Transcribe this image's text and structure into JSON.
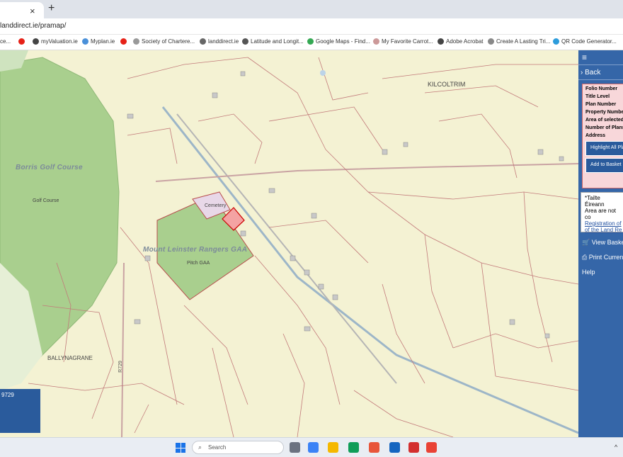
{
  "browser": {
    "tab_close": "×",
    "new_tab": "+",
    "url": "landdirect.ie/pramap/",
    "bookmarks": [
      {
        "label": "ce...",
        "color": "#888888"
      },
      {
        "label": "",
        "color": "#e62117"
      },
      {
        "label": "myValuation.ie",
        "color": "#444444"
      },
      {
        "label": "Myplan.ie",
        "color": "#4a90d9"
      },
      {
        "label": "",
        "color": "#e62117"
      },
      {
        "label": "Society of Chartere...",
        "color": "#999999"
      },
      {
        "label": "landdirect.ie",
        "color": "#666666"
      },
      {
        "label": "Latitude and Longit...",
        "color": "#555555"
      },
      {
        "label": "Google Maps - Find...",
        "color": "#34a853"
      },
      {
        "label": "My Favorite Carrot...",
        "color": "#cc9999"
      },
      {
        "label": "Adobe Acrobat",
        "color": "#444444"
      },
      {
        "label": "Create A Lasting Tri...",
        "color": "#888888"
      },
      {
        "label": "QR Code Generator...",
        "color": "#2d9cdb"
      }
    ]
  },
  "map": {
    "labels": {
      "kilcoltrim": "KILCOLTRIM",
      "borris_golf": "Borris Golf Course",
      "golf_course": "Golf Course",
      "cemetery": "Cemetery",
      "gaa": "Mount Leinster Rangers GAA",
      "pitch": "Pitch GAA",
      "ballynagrane": "BALLYNAGRANE",
      "road": "R729"
    },
    "coord_text": "9729"
  },
  "sidebar": {
    "menu_icon": "≡",
    "back": "Back",
    "info_rows": [
      "Folio Number",
      "Title Level",
      "Plan Number",
      "Property Number",
      "Area of selected",
      "Number of Plans this folio:",
      "Address"
    ],
    "highlight_button": "Highlight All Plans",
    "add_basket_button": "Add to Basket",
    "notice_text": "*Tailte Éireann",
    "notice_text2": "Area are not co",
    "notice_link1": "Registration of",
    "notice_link2": "of the Land Re",
    "view_basket": "View Basket",
    "print": "Print Current",
    "help": "Help"
  },
  "taskbar": {
    "search_placeholder": "Search",
    "search_icon": "search-icon",
    "icons": [
      {
        "name": "task-view-icon",
        "color": "#6b7280"
      },
      {
        "name": "store-icon",
        "color": "#3b82f6"
      },
      {
        "name": "file-explorer-icon",
        "color": "#f5b800"
      },
      {
        "name": "edge-icon",
        "color": "#0f9d58"
      },
      {
        "name": "mail-icon",
        "color": "#e8553a"
      },
      {
        "name": "outlook-icon",
        "color": "#1565c0"
      },
      {
        "name": "acrobat-icon",
        "color": "#d32f2f"
      },
      {
        "name": "chrome-icon",
        "color": "#e94235"
      }
    ],
    "tray_text": "^"
  }
}
